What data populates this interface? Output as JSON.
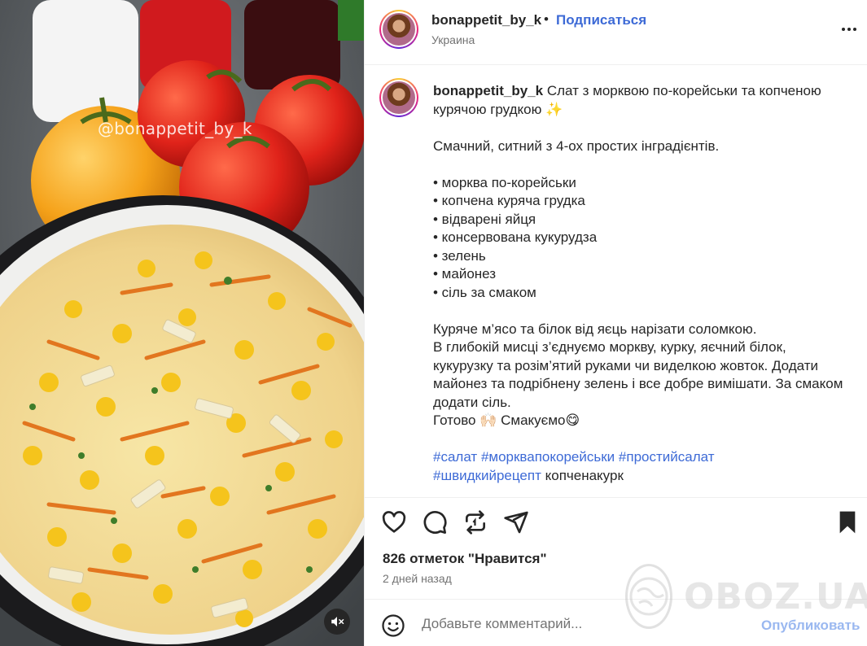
{
  "media": {
    "watermark": "@bonappetit_by_k",
    "mute_icon": "speaker-muted-icon"
  },
  "header": {
    "username": "bonappetit_by_k",
    "separator": "•",
    "follow_label": "Подписаться",
    "location": "Украина",
    "more_icon": "more-horizontal-icon"
  },
  "caption": {
    "username": "bonappetit_by_k",
    "title": "Слат з морквою по-корейськи та копченою курячою грудкою ✨",
    "intro": "Смачний, ситний з 4-ох простих інградієнтів.",
    "ingredients": [
      "• морква по-корейськи",
      "• копчена куряча грудка",
      "• відварені яйця",
      "• консервована кукурудза",
      "• зелень",
      "• майонез",
      "• сіль за смаком"
    ],
    "steps": [
      "Куряче м’ясо та білок від яєць нарізати соломкою.",
      "В глибокій мисці з’єднуємо моркву, курку, яєчний білок, кукурузку та розім’ятий руками чи виделкою жовток. Додати майонез та подрібнену зелень і все добре вимішати. За смаком додати сіль.",
      "Готово 🙌🏻 Смакуємо😋"
    ],
    "hashtags": [
      "#салат",
      "#морквапокорейськи",
      "#простийсалат",
      "#швидкийрецепт"
    ],
    "trailing_text": "копченакурк"
  },
  "actions": {
    "like_icon": "heart-icon",
    "comment_icon": "comment-icon",
    "repost_icon": "repost-icon",
    "share_icon": "send-icon",
    "save_icon": "bookmark-icon",
    "likes": "826 отметок \"Нравится\"",
    "time": "2 дней назад"
  },
  "comment": {
    "emoji_icon": "smiley-icon",
    "placeholder": "Добавьте комментарий...",
    "publish_label": "Опубликовать"
  },
  "overlay": {
    "brand": "OBOZ.UA"
  },
  "colors": {
    "link": "#3d6ad6",
    "publish_disabled": "#9ab8f0",
    "text": "#262626",
    "muted": "#737373"
  }
}
